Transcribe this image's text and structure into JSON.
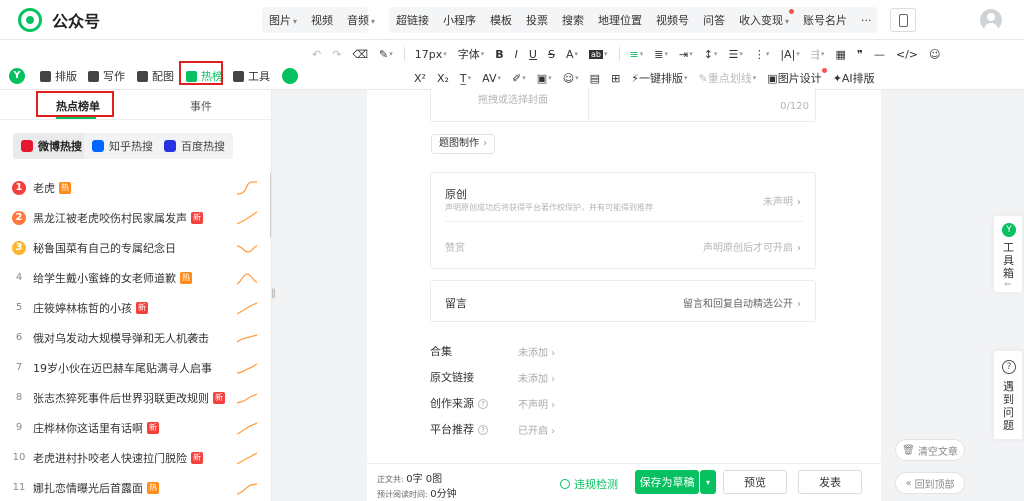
{
  "app": {
    "name": "公众号"
  },
  "top_menu": {
    "group1": [
      {
        "label": "图片",
        "caret": true
      },
      {
        "label": "视频",
        "caret": false
      },
      {
        "label": "音频",
        "caret": true
      }
    ],
    "group2": [
      {
        "label": "超链接"
      },
      {
        "label": "小程序"
      },
      {
        "label": "模板"
      },
      {
        "label": "投票"
      },
      {
        "label": "搜索"
      },
      {
        "label": "地理位置"
      },
      {
        "label": "视频号"
      },
      {
        "label": "问答"
      },
      {
        "label": "收入变现",
        "caret": true,
        "dot": true
      },
      {
        "label": "账号名片"
      },
      {
        "label": "···"
      }
    ]
  },
  "format_toolbar": {
    "font_size": "17px",
    "font_family": "字体",
    "bold": "B",
    "italic": "I",
    "underline": "U",
    "strike": "S",
    "case": "A",
    "one_click": "一键排版",
    "highlight": "重点划线",
    "image_design": "图片设计",
    "ai_layout": "AI排版"
  },
  "left_tools": {
    "badge": "Y",
    "items": [
      {
        "label": "排版"
      },
      {
        "label": "写作"
      },
      {
        "label": "配图"
      },
      {
        "label": "热榜",
        "active": true
      },
      {
        "label": "工具"
      }
    ]
  },
  "hot_panel": {
    "tabs": [
      "热点榜单",
      "事件"
    ],
    "sources": [
      {
        "label": "微博热搜",
        "color": "#e6162d",
        "active": true
      },
      {
        "label": "知乎热搜",
        "color": "#0066ff"
      },
      {
        "label": "百度热搜",
        "color": "#2932e1"
      }
    ],
    "colors": {
      "hot": "#ff8c1a",
      "new": "#f5413c",
      "rank1": "#f5413c",
      "rank2": "#ff7a3c",
      "rank3": "#ffb733",
      "trend": "#ff9a3c"
    },
    "items": [
      {
        "rank": "1",
        "title": "老虎",
        "tag": "热"
      },
      {
        "rank": "2",
        "title": "黑龙江被老虎咬伤村民家属发声",
        "tag": "新"
      },
      {
        "rank": "3",
        "title": "秘鲁国菜有自己的专属纪念日",
        "tag": ""
      },
      {
        "rank": "4",
        "title": "给学生戴小蜜蜂的女老师道歉",
        "tag": "热"
      },
      {
        "rank": "5",
        "title": "庄筱婷林栋哲的小孩",
        "tag": "新"
      },
      {
        "rank": "6",
        "title": "俄对乌发动大规模导弹和无人机袭击",
        "tag": ""
      },
      {
        "rank": "7",
        "title": "19岁小伙在迈巴赫车尾贴满寻人启事",
        "tag": ""
      },
      {
        "rank": "8",
        "title": "张志杰猝死事件后世界羽联更改规则",
        "tag": "新"
      },
      {
        "rank": "9",
        "title": "庄桦林你这话里有话啊",
        "tag": "新"
      },
      {
        "rank": "10",
        "title": "老虎进村扑咬老人快速拉门脱险",
        "tag": "新"
      },
      {
        "rank": "11",
        "title": "娜扎恋情曝光后首露面",
        "tag": "热"
      }
    ]
  },
  "editor": {
    "cover_placeholder": "拖拽或选择封面",
    "char_count": "0/120",
    "cover_tool": "题图制作",
    "original": {
      "title": "原创",
      "desc": "声明原创成功后将获得平台著作权保护，并有可能得到推荐",
      "value": "未声明"
    },
    "reward": {
      "title": "赞赏",
      "value": "声明原创后才可开启"
    },
    "comment": {
      "title": "留言",
      "value": "留言和回复自动精选公开"
    },
    "settings": [
      {
        "label": "合集",
        "value": "未添加",
        "help": false
      },
      {
        "label": "原文链接",
        "value": "未添加",
        "help": false
      },
      {
        "label": "创作来源",
        "value": "不声明",
        "help": true
      },
      {
        "label": "平台推荐",
        "value": "已开启",
        "help": true
      }
    ]
  },
  "bottom_bar": {
    "word_count_label": "正文共:",
    "word_count": "0字 0图",
    "read_time_label": "预计阅读时间:",
    "read_time": "0分钟",
    "check": "违规检测",
    "save": "保存为草稿",
    "preview": "预览",
    "publish": "发表"
  },
  "right_float": {
    "toolbox": "工具箱",
    "help": "遇到问题",
    "clear": "清空文章",
    "back_top": "回到顶部"
  }
}
